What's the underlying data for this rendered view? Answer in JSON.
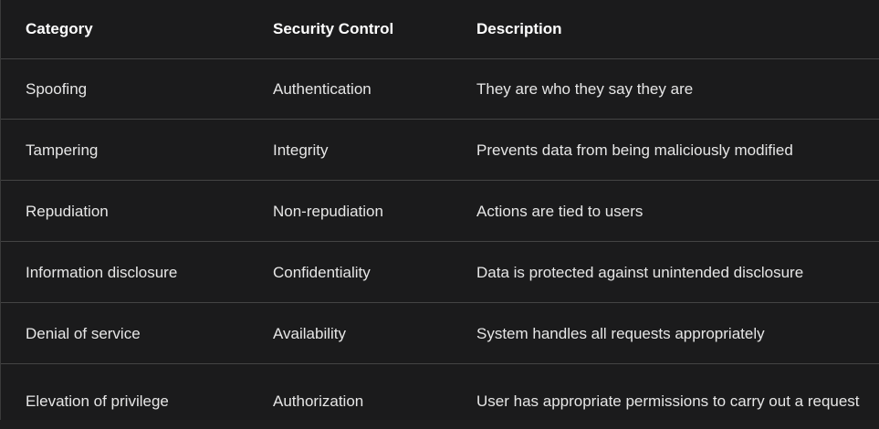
{
  "headers": {
    "category": "Category",
    "control": "Security Control",
    "description": "Description"
  },
  "rows": [
    {
      "category": "Spoofing",
      "control": "Authentication",
      "description": "They are who they say they are"
    },
    {
      "category": "Tampering",
      "control": "Integrity",
      "description": "Prevents data from being maliciously modified"
    },
    {
      "category": "Repudiation",
      "control": "Non-repudiation",
      "description": "Actions are tied to users"
    },
    {
      "category": "Information disclosure",
      "control": "Confidentiality",
      "description": "Data is protected against unintended disclosure"
    },
    {
      "category": "Denial of service",
      "control": "Availability",
      "description": "System handles all requests appropriately"
    },
    {
      "category": "Elevation of privilege",
      "control": "Authorization",
      "description": "User has appropriate permissions to carry out a request"
    }
  ]
}
